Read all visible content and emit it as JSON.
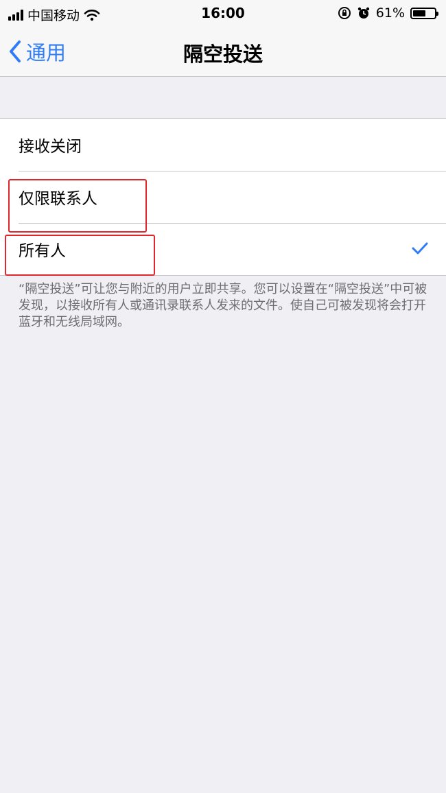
{
  "status_bar": {
    "carrier": "中国移动",
    "time": "16:00",
    "battery_percent": "61%",
    "battery_level": 0.61,
    "icons": [
      "signal-icon",
      "wifi-icon",
      "orientation-lock-icon",
      "alarm-icon",
      "battery-icon"
    ]
  },
  "nav": {
    "back_label": "通用",
    "title": "隔空投送"
  },
  "options": [
    {
      "label": "接收关闭",
      "selected": false
    },
    {
      "label": "仅限联系人",
      "selected": false
    },
    {
      "label": "所有人",
      "selected": true
    }
  ],
  "footer_note": "“隔空投送”可让您与附近的用户立即共享。您可以设置在“隔空投送”中可被发现，以接收所有人或通讯录联系人发来的文件。使自己可被发现将会打开蓝牙和无线局域网。",
  "colors": {
    "accent": "#2f7cf6",
    "annotation": "#e0262c",
    "background": "#efeff4"
  }
}
